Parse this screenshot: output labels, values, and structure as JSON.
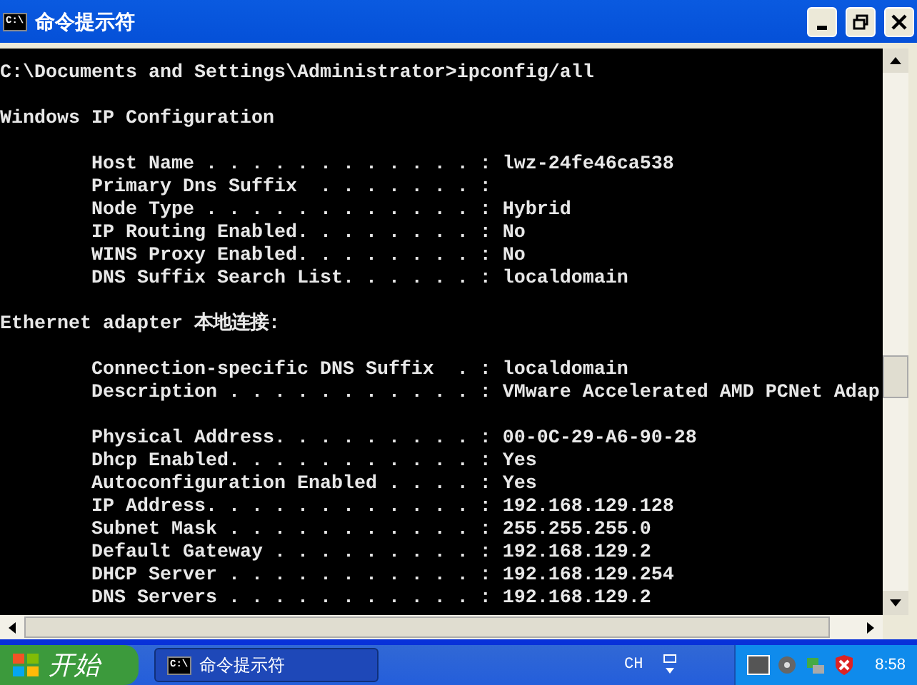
{
  "window": {
    "title": "命令提示符",
    "icon": "C:\\"
  },
  "console": {
    "blocks": [
      [
        "C:\\Documents and Settings\\Administrator>ipconfig/all"
      ],
      [
        "Windows IP Configuration"
      ],
      [
        "        Host Name . . . . . . . . . . . . : lwz-24fe46ca538",
        "        Primary Dns Suffix  . . . . . . . :",
        "        Node Type . . . . . . . . . . . . : Hybrid",
        "        IP Routing Enabled. . . . . . . . : No",
        "        WINS Proxy Enabled. . . . . . . . : No",
        "        DNS Suffix Search List. . . . . . : localdomain"
      ],
      [
        "Ethernet adapter 本地连接:"
      ],
      [
        "        Connection-specific DNS Suffix  . : localdomain",
        "        Description . . . . . . . . . . . : VMware Accelerated AMD PCNet Adap"
      ],
      [
        "        Physical Address. . . . . . . . . : 00-0C-29-A6-90-28",
        "        Dhcp Enabled. . . . . . . . . . . : Yes",
        "        Autoconfiguration Enabled . . . . : Yes",
        "        IP Address. . . . . . . . . . . . : 192.168.129.128",
        "        Subnet Mask . . . . . . . . . . . : 255.255.255.0",
        "        Default Gateway . . . . . . . . . : 192.168.129.2",
        "        DHCP Server . . . . . . . . . . . : 192.168.129.254",
        "        DNS Servers . . . . . . . . . . . : 192.168.129.2"
      ]
    ]
  },
  "taskbar": {
    "start": "开始",
    "tasks": [
      {
        "label": "命令提示符",
        "icon": "C:\\",
        "selected": true
      }
    ],
    "language": "CH",
    "clock": "8:58"
  }
}
